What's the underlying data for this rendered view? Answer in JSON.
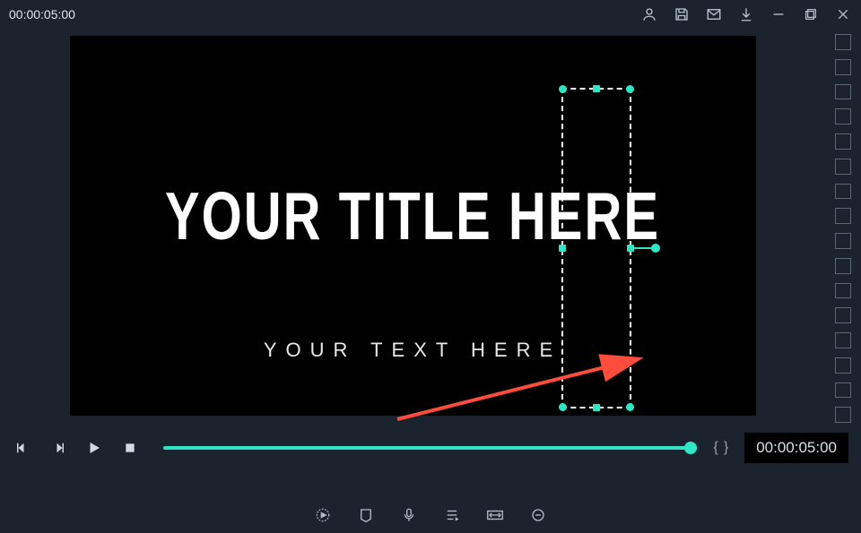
{
  "topbar": {
    "timecode": "00:00:05:00"
  },
  "canvas": {
    "title": "YOUR TITLE HERE",
    "subtitle": "YOUR TEXT HERE"
  },
  "player": {
    "right_timecode": "00:00:05:00"
  },
  "icons": {
    "profile": "profile",
    "save": "save",
    "mail": "mail",
    "download": "download",
    "minimize": "minimize",
    "maximize": "maximize",
    "close": "close"
  }
}
